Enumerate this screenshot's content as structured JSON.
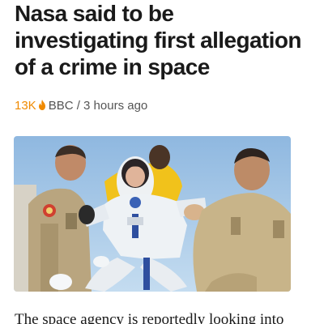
{
  "article": {
    "headline_lines": [
      "Nasa said to be",
      "investigating first allegation",
      "of a crime in space"
    ],
    "meta": {
      "count": "13K",
      "count_icon": "flame-icon",
      "source_time": "BBC / 3 hours ago"
    },
    "image": {
      "subject": "astronaut-in-spacesuit-carried-by-ground-crew"
    },
    "body_preview": "The space agency is reportedly looking into"
  },
  "colors": {
    "count_accent": "#f08a00",
    "text_primary": "#1a1a1a",
    "text_meta": "#555555",
    "sky": "#9ec3e6"
  }
}
